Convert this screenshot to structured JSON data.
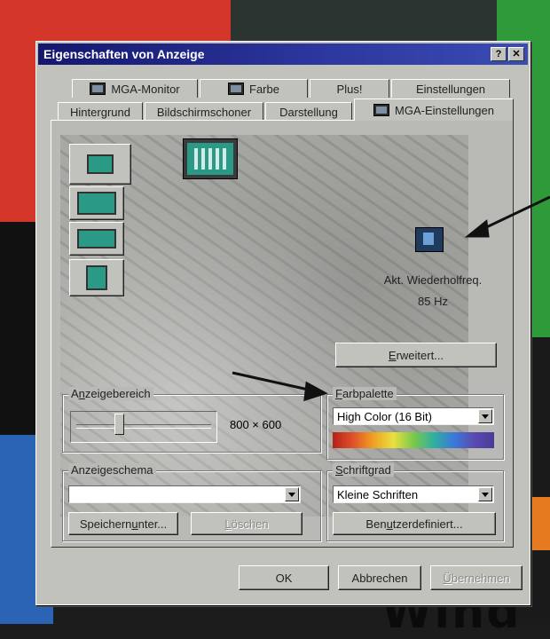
{
  "window": {
    "title": "Eigenschaften von Anzeige",
    "help_btn": "?",
    "close_btn": "✕"
  },
  "tabs_back": [
    "MGA-Monitor",
    "Farbe",
    "Plus!",
    "Einstellungen"
  ],
  "tabs_front": [
    "Hintergrund",
    "Bildschirmschoner",
    "Darstellung",
    "MGA-Einstellungen"
  ],
  "active_tab": "MGA-Einstellungen",
  "refresh": {
    "label": "Akt. Wiederholfreq.",
    "value": "85 Hz"
  },
  "advanced_btn": {
    "pre": "",
    "ul": "E",
    "post": "rweitert..."
  },
  "display_area": {
    "label_pre": "A",
    "label_ul": "n",
    "label_post": "zeigebereich",
    "value": "800 × 600",
    "slider_position": 0.3
  },
  "palette": {
    "label_pre": "",
    "label_ul": "F",
    "label_post": "arbpalette",
    "selected": "High Color (16 Bit)"
  },
  "scheme": {
    "label": "Anzeigeschema",
    "selected": "",
    "save_btn": {
      "pre": "Speichern ",
      "ul": "u",
      "post": "nter..."
    },
    "delete_btn": {
      "pre": "",
      "ul": "L",
      "post": "öschen"
    }
  },
  "font_size": {
    "label_pre": "",
    "label_ul": "S",
    "label_post": "chriftgrad",
    "selected": "Kleine Schriften",
    "custom_btn": {
      "pre": "Ben",
      "ul": "u",
      "post": "tzerdefiniert..."
    }
  },
  "footer": {
    "ok": "OK",
    "cancel": "Abbrechen",
    "apply": {
      "pre": "",
      "ul": "Ü",
      "post": "bernehmen"
    }
  },
  "colors": {
    "title_start": "#15176e",
    "title_end": "#3a4cb4",
    "dialog": "#c2c2bd",
    "monitor_screen": "#2a9a86"
  },
  "background_text": "Wind"
}
